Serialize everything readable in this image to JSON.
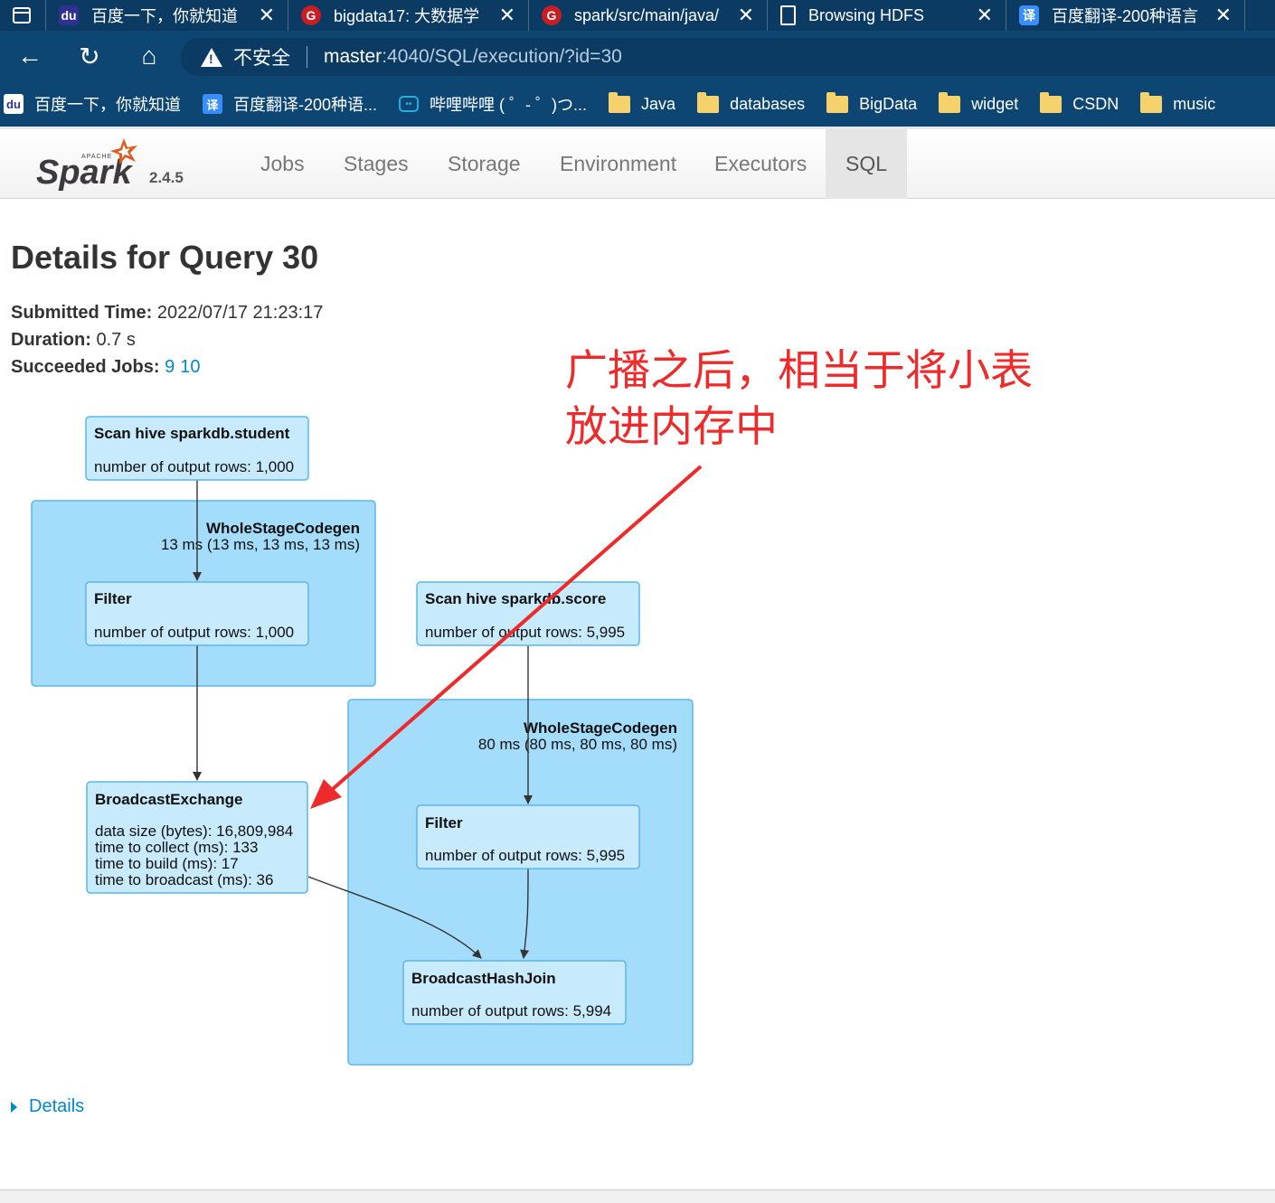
{
  "browser": {
    "tabs": [
      {
        "label": "百度一下，你就知道",
        "icon": "baidu-paw-icon"
      },
      {
        "label": "bigdata17: 大数据学",
        "icon": "gitee-g-icon"
      },
      {
        "label": "spark/src/main/java/",
        "icon": "gitee-g-icon"
      },
      {
        "label": "Browsing HDFS",
        "icon": "document-icon"
      },
      {
        "label": "百度翻译-200种语言",
        "icon": "translate-icon"
      }
    ],
    "close_glyph": "✕",
    "address": {
      "warning": "不安全",
      "host": "master",
      "path": ":4040/SQL/execution/?id=30"
    },
    "bookmarks": [
      {
        "label": "百度一下，你就知道",
        "icon": "baidu-paw-icon"
      },
      {
        "label": "百度翻译-200种语...",
        "icon": "translate-icon"
      },
      {
        "label": "哔哩哔哩 ( ゜- ゜)つ...",
        "icon": "bilibili-tv-icon"
      },
      {
        "label": "Java",
        "icon": "folder-icon"
      },
      {
        "label": "databases",
        "icon": "folder-icon"
      },
      {
        "label": "BigData",
        "icon": "folder-icon"
      },
      {
        "label": "widget",
        "icon": "folder-icon"
      },
      {
        "label": "CSDN",
        "icon": "folder-icon"
      },
      {
        "label": "music",
        "icon": "folder-icon"
      }
    ]
  },
  "spark": {
    "logo_text": "Spark",
    "logo_apache": "APACHE",
    "version": "2.4.5",
    "nav": [
      "Jobs",
      "Stages",
      "Storage",
      "Environment",
      "Executors",
      "SQL"
    ],
    "active_nav": "SQL"
  },
  "page": {
    "title": "Details for Query 30",
    "submitted_label": "Submitted Time:",
    "submitted_value": "2022/07/17 21:23:17",
    "duration_label": "Duration:",
    "duration_value": "0.7 s",
    "jobs_label": "Succeeded Jobs:",
    "jobs": [
      "9",
      "10"
    ],
    "details_label": "Details"
  },
  "annotation": {
    "line1": "广播之后，相当于将小表",
    "line2": "放进内存中",
    "color": "#ee2a2a"
  },
  "plan": {
    "colors": {
      "cluster_fill": "#a4dcfb",
      "cluster_stroke": "#5bb7ea",
      "node_fill": "#c8eafd",
      "node_stroke": "#5bb7ea"
    },
    "cluster1": {
      "name": "WholeStageCodegen",
      "metric": "13 ms (13 ms, 13 ms, 13 ms)"
    },
    "cluster2": {
      "name": "WholeStageCodegen",
      "metric": "80 ms (80 ms, 80 ms, 80 ms)"
    },
    "scan_student": {
      "name": "Scan hive sparkdb.student",
      "metric": "number of output rows: 1,000"
    },
    "filter1": {
      "name": "Filter",
      "metric": "number of output rows: 1,000"
    },
    "scan_score": {
      "name": "Scan hive sparkdb.score",
      "metric": "number of output rows: 5,995"
    },
    "filter2": {
      "name": "Filter",
      "metric": "number of output rows: 5,995"
    },
    "broadcast_exchange": {
      "name": "BroadcastExchange",
      "metrics": [
        "data size (bytes): 16,809,984",
        "time to collect (ms): 133",
        "time to build (ms): 17",
        "time to broadcast (ms): 36"
      ]
    },
    "hash_join": {
      "name": "BroadcastHashJoin",
      "metric": "number of output rows: 5,994"
    }
  }
}
